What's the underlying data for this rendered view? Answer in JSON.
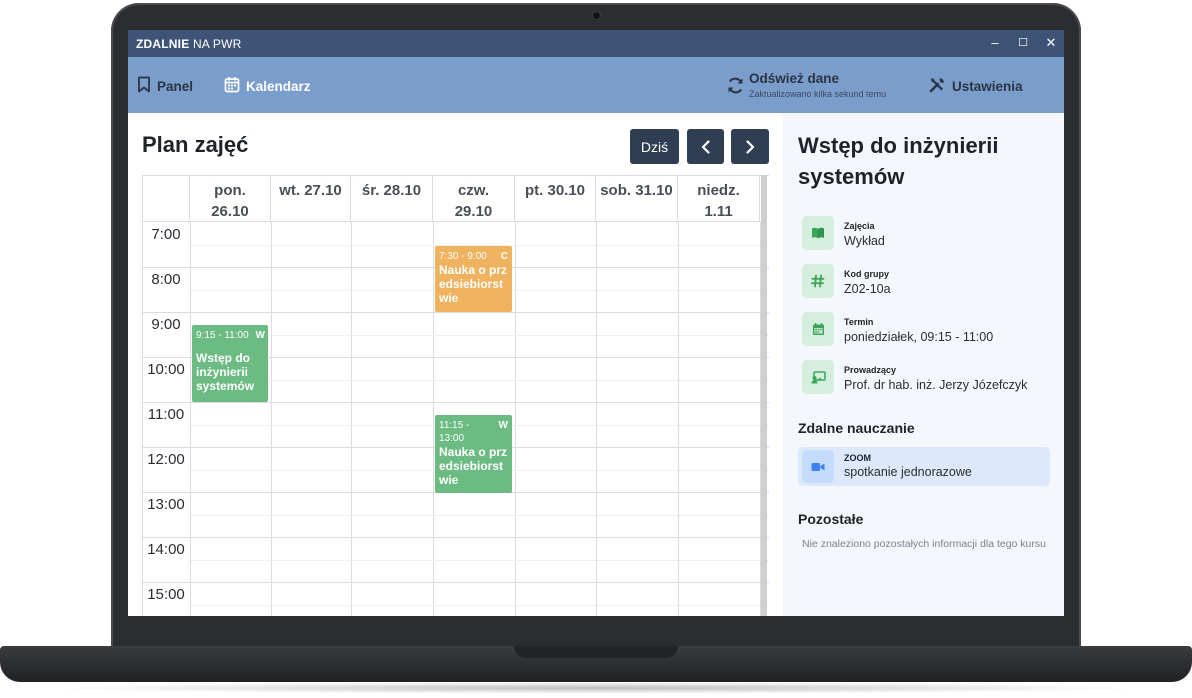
{
  "app": {
    "brand_bold": "ZDALNIE",
    "brand_rest": " NA PWR",
    "window_controls": {
      "minimize": "–",
      "maximize": "☐",
      "close": "✕"
    }
  },
  "toolbar": {
    "nav": [
      {
        "label": "Panel",
        "icon": "bookmark-icon"
      },
      {
        "label": "Kalendarz",
        "icon": "calendar-icon"
      }
    ],
    "refresh_label": "Odśwież dane",
    "refresh_status": "Zaktualizowano kilka sekund temu",
    "settings_label": "Ustawienia"
  },
  "main": {
    "title": "Plan zajęć",
    "today_label": "Dziś",
    "prev_icon": "‹",
    "next_icon": "›"
  },
  "calendar": {
    "days": [
      {
        "line1": "pon.",
        "line2": "26.10"
      },
      {
        "line1": "wt. 27.10",
        "line2": ""
      },
      {
        "line1": "śr. 28.10",
        "line2": ""
      },
      {
        "line1": "czw.",
        "line2": "29.10"
      },
      {
        "line1": "pt. 30.10",
        "line2": ""
      },
      {
        "line1": "sob. 31.10",
        "line2": ""
      },
      {
        "line1": "niedz.",
        "line2": "1.11"
      }
    ],
    "hours": [
      "7:00",
      "8:00",
      "9:00",
      "10:00",
      "11:00",
      "12:00",
      "13:00",
      "14:00",
      "15:00"
    ],
    "events": [
      {
        "time": "9:15 - 11:00",
        "code": "W",
        "name": "Wstęp do inżynierii systemów",
        "color": "#6cbb82"
      },
      {
        "time": "7:30 - 9:00",
        "code": "C",
        "name": "Nauka o przedsiebiorstwie",
        "color": "#efb25e"
      },
      {
        "time": "11:15 - 13:00",
        "code": "W",
        "name": "Nauka o przedsiebiorstwie",
        "color": "#6cbb82"
      }
    ]
  },
  "details": {
    "title": "Wstęp do inżynierii systemów",
    "rows": [
      {
        "label": "Zajęcia",
        "value": "Wykład",
        "icon": "book-icon"
      },
      {
        "label": "Kod grupy",
        "value": "Z02-10a",
        "icon": "hash-icon"
      },
      {
        "label": "Termin",
        "value": "poniedziałek, 09:15 - 11:00",
        "icon": "calendar-icon"
      },
      {
        "label": "Prowadzący",
        "value": "Prof. dr hab. inż. Jerzy Józefczyk",
        "icon": "teacher-icon"
      }
    ],
    "remote_heading": "Zdalne nauczanie",
    "remote_label": "ZOOM",
    "remote_value": "spotkanie jednorazowe",
    "other_heading": "Pozostałe",
    "other_note": "Nie znaleziono pozostałych informacji dla tego kursu"
  }
}
